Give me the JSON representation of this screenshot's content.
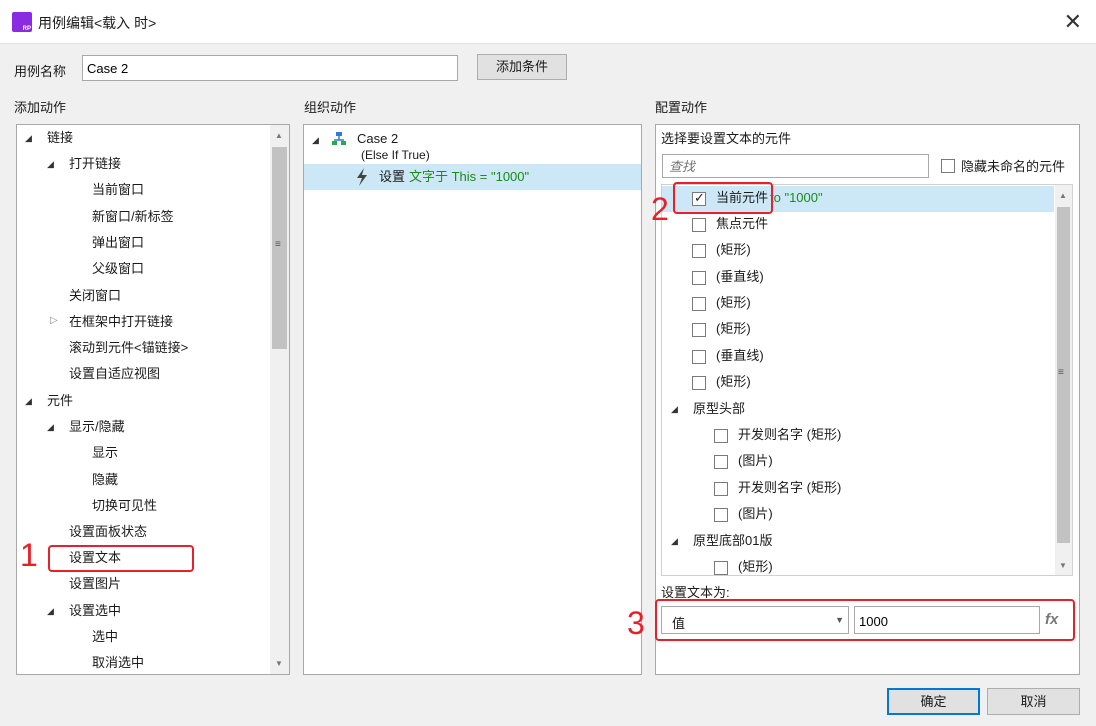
{
  "window": {
    "title": "用例编辑<载入 时>",
    "close_glyph": "✕"
  },
  "case_name": {
    "label": "用例名称",
    "value": "Case 2",
    "add_condition": "添加条件"
  },
  "add_actions": {
    "header": "添加动作",
    "items": [
      "链接",
      "打开链接",
      "当前窗口",
      "新窗口/新标签",
      "弹出窗口",
      "父级窗口",
      "关闭窗口",
      "在框架中打开链接",
      "滚动到元件<锚链接>",
      "设置自适应视图",
      "元件",
      "显示/隐藏",
      "显示",
      "隐藏",
      "切换可见性",
      "设置面板状态",
      "设置文本",
      "设置图片",
      "设置选中",
      "选中",
      "取消选中"
    ]
  },
  "organize": {
    "header": "组织动作",
    "case_title": "Case 2",
    "case_condition": "(Else If True)",
    "action_verb": "设置",
    "action_detail": "文字于 This = \"1000\""
  },
  "configure": {
    "header": "配置动作",
    "sub_header": "选择要设置文本的元件",
    "search_placeholder": "查找",
    "hide_unnamed": "隐藏未命名的元件",
    "widgets": [
      {
        "label": "当前元件",
        "suffix": "to \"1000\"",
        "checked": true
      },
      {
        "label": "焦点元件",
        "checked": false
      },
      {
        "label": "(矩形)",
        "checked": false
      },
      {
        "label": "(垂直线)",
        "checked": false
      },
      {
        "label": "(矩形)",
        "checked": false
      },
      {
        "label": "(矩形)",
        "checked": false
      },
      {
        "label": "(垂直线)",
        "checked": false
      },
      {
        "label": "(矩形)",
        "checked": false
      },
      {
        "label": "原型头部",
        "group": true
      },
      {
        "label": "开发则名字 (矩形)",
        "checked": false
      },
      {
        "label": "(图片)",
        "checked": false
      },
      {
        "label": "开发则名字 (矩形)",
        "checked": false
      },
      {
        "label": "(图片)",
        "checked": false
      },
      {
        "label": "原型底部01版",
        "group": true
      },
      {
        "label": "(矩形)",
        "checked": false
      }
    ],
    "set_text_label": "设置文本为:",
    "value_type": "值",
    "value": "1000",
    "fx_label": "fx"
  },
  "footer": {
    "ok": "确定",
    "cancel": "取消"
  },
  "annotations": {
    "n1": "1",
    "n2": "2",
    "n3": "3"
  },
  "colors": {
    "accent": "#0078d7",
    "annotation": "#e8202a",
    "selection": "#cce8f6",
    "green_text": "#1a8a1a"
  }
}
